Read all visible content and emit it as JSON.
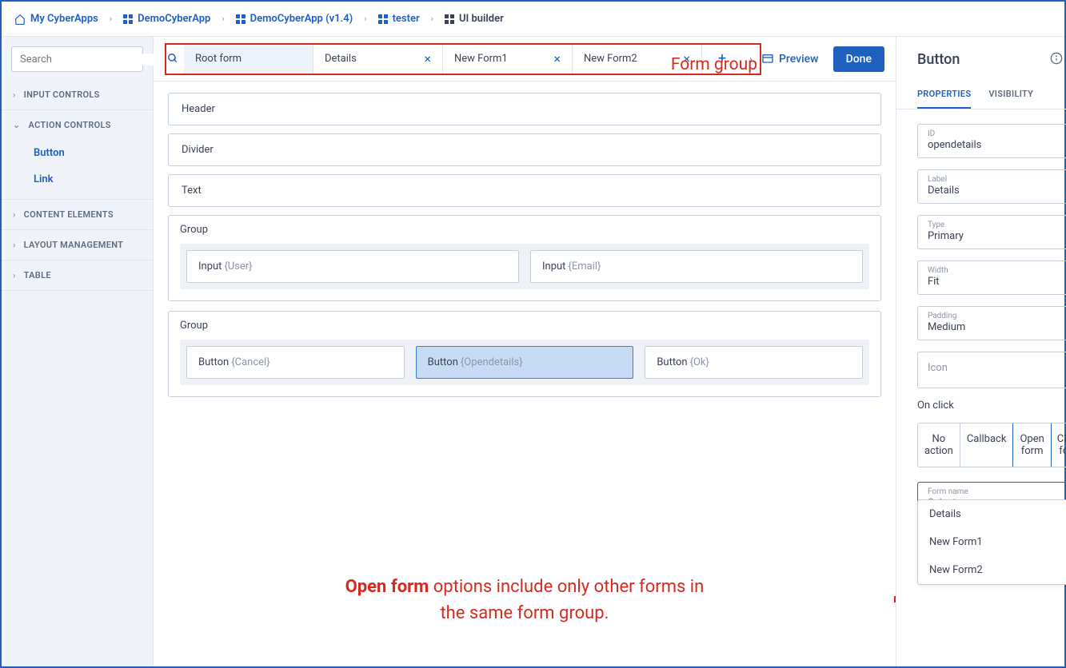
{
  "breadcrumb": [
    {
      "label": "My CyberApps",
      "icon": "home"
    },
    {
      "label": "DemoCyberApp",
      "icon": "grid"
    },
    {
      "label": "DemoCyberApp (v1.4)",
      "icon": "grid"
    },
    {
      "label": "tester",
      "icon": "grid"
    },
    {
      "label": "UI builder",
      "icon": "grid-dark",
      "last": true
    }
  ],
  "search": {
    "placeholder": "Search"
  },
  "sidebar": {
    "sections": [
      {
        "label": "INPUT CONTROLS",
        "expanded": false
      },
      {
        "label": "ACTION CONTROLS",
        "expanded": true,
        "items": [
          "Button",
          "Link"
        ]
      },
      {
        "label": "CONTENT ELEMENTS",
        "expanded": false
      },
      {
        "label": "LAYOUT MANAGEMENT",
        "expanded": false
      },
      {
        "label": "TABLE",
        "expanded": false
      }
    ]
  },
  "formtabs": {
    "items": [
      {
        "label": "Root form",
        "closable": false,
        "active": true
      },
      {
        "label": "Details",
        "closable": true
      },
      {
        "label": "New Form1",
        "closable": true
      },
      {
        "label": "New Form2",
        "closable": true
      }
    ],
    "annotation": "Form group"
  },
  "topbar": {
    "preview": "Preview",
    "done": "Done"
  },
  "canvas": {
    "widgets": [
      {
        "type": "simple",
        "label": "Header"
      },
      {
        "type": "simple",
        "label": "Divider"
      },
      {
        "type": "simple",
        "label": "Text"
      },
      {
        "type": "group",
        "label": "Group",
        "items": [
          {
            "kind": "Input",
            "sub": "{User}"
          },
          {
            "kind": "Input",
            "sub": "{Email}"
          }
        ]
      },
      {
        "type": "group",
        "label": "Group",
        "items": [
          {
            "kind": "Button",
            "sub": "{Cancel}"
          },
          {
            "kind": "Button",
            "sub": "{Opendetails}",
            "selected": true
          },
          {
            "kind": "Button",
            "sub": "{Ok}"
          }
        ]
      }
    ],
    "annotation_bold": "Open form",
    "annotation_rest": " options include only other forms in the same form group."
  },
  "rpanel": {
    "title": "Button",
    "tabs": [
      "PROPERTIES",
      "VISIBILITY"
    ],
    "active_tab": 0,
    "fields": {
      "id": {
        "label": "ID",
        "value": "opendetails"
      },
      "label": {
        "label": "Label",
        "value": "Details"
      },
      "type": {
        "label": "Type",
        "value": "Primary"
      },
      "width": {
        "label": "Width",
        "value": "Fit"
      },
      "padding": {
        "label": "Padding",
        "value": "Medium"
      },
      "icon": {
        "label": "Icon",
        "value": ""
      },
      "onclick_label": "On click",
      "onclick_opts": [
        "No action",
        "Callback",
        "Open form",
        "Close form"
      ],
      "onclick_selected": 2,
      "formname": {
        "label": "Form name",
        "value": "Select"
      },
      "dropdown": [
        "Details",
        "New Form1",
        "New Form2"
      ]
    }
  }
}
